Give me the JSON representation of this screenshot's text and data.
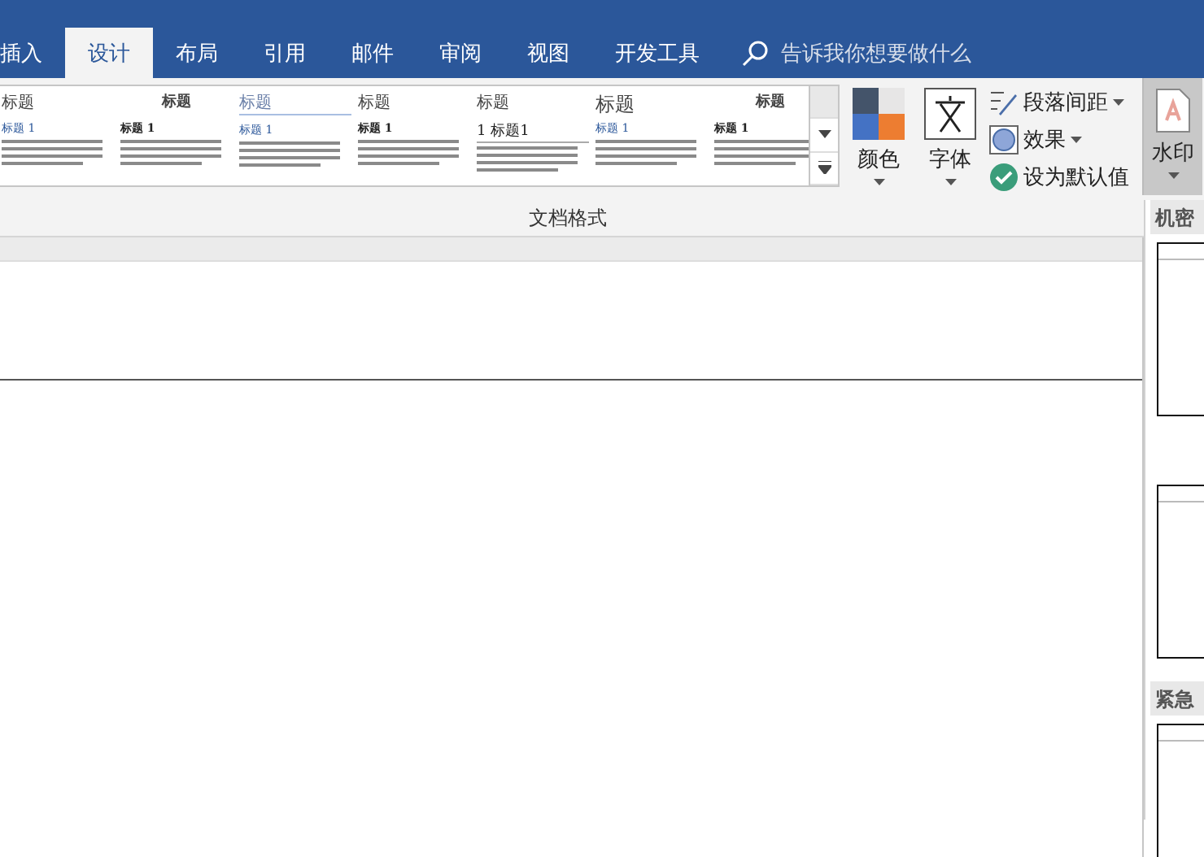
{
  "tabs": [
    {
      "label": "插入",
      "selected": false
    },
    {
      "label": "设计",
      "selected": true
    },
    {
      "label": "布局",
      "selected": false
    },
    {
      "label": "引用",
      "selected": false
    },
    {
      "label": "邮件",
      "selected": false
    },
    {
      "label": "审阅",
      "selected": false
    },
    {
      "label": "视图",
      "selected": false
    },
    {
      "label": "开发工具",
      "selected": false
    }
  ],
  "tell_me": {
    "placeholder": "告诉我你想要做什么"
  },
  "gallery": [
    {
      "title": "标题",
      "heading": "标题 1"
    },
    {
      "title": "标题",
      "heading": "标题 1"
    },
    {
      "title": "标题",
      "heading": "标题 1"
    },
    {
      "title": "标题",
      "heading": "标题 1"
    },
    {
      "title": "标题",
      "heading": "1 标题1"
    },
    {
      "title": "标题",
      "heading": "标题 1"
    },
    {
      "title": "标题",
      "heading": "标题 1"
    }
  ],
  "colors_button": {
    "label": "颜色"
  },
  "fonts_button": {
    "label": "字体"
  },
  "side_commands": [
    {
      "label": "段落间距",
      "dropdown": true
    },
    {
      "label": "效果",
      "dropdown": true
    },
    {
      "label": "设为默认值",
      "dropdown": false
    }
  ],
  "group_label": "文档格式",
  "watermark_button": {
    "label": "水印"
  },
  "watermark_sections": [
    {
      "header": "机密",
      "thumbnails": [
        {
          "kind": "blank"
        },
        {
          "kind": "blank"
        }
      ]
    },
    {
      "header": "紧急",
      "thumbnails": [
        {
          "kind": "blank"
        }
      ]
    }
  ]
}
